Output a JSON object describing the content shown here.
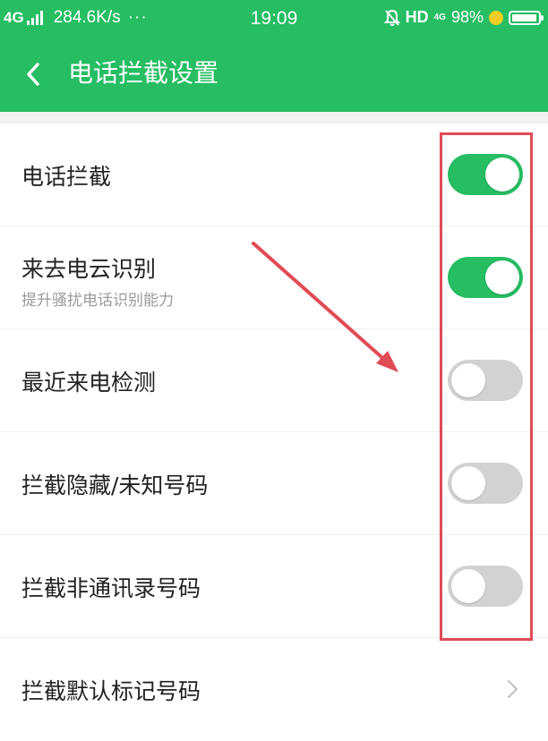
{
  "status_bar": {
    "network": "4G",
    "speed": "284.6K/s",
    "dots": "···",
    "time": "19:09",
    "hd": "HD",
    "net_small": "4G",
    "battery_percent": "98%",
    "battery_level": 0.98
  },
  "header": {
    "title": "电话拦截设置",
    "back_icon": "chevron-left-icon"
  },
  "settings": [
    {
      "label": "电话拦截",
      "subtitle": "",
      "control": "toggle",
      "on": true
    },
    {
      "label": "来去电云识别",
      "subtitle": "提升骚扰电话识别能力",
      "control": "toggle",
      "on": true
    },
    {
      "label": "最近来电检测",
      "subtitle": "",
      "control": "toggle",
      "on": false
    },
    {
      "label": "拦截隐藏/未知号码",
      "subtitle": "",
      "control": "toggle",
      "on": false
    },
    {
      "label": "拦截非通讯录号码",
      "subtitle": "",
      "control": "toggle",
      "on": false
    },
    {
      "label": "拦截默认标记号码",
      "subtitle": "",
      "control": "chevron"
    }
  ],
  "colors": {
    "accent": "#26bd63",
    "toggle_off": "#d2d2d2",
    "annotation": "#e04b55"
  }
}
